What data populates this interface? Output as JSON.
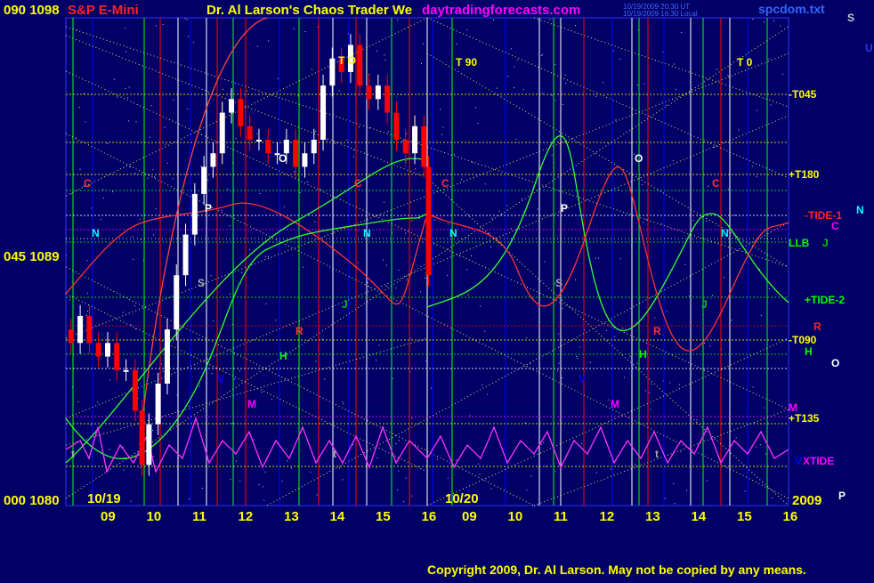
{
  "header": {
    "axis_top": "090  1098",
    "instrument": "S&P E-Mini",
    "title": "Dr. Al Larson's Chaos Trader We",
    "site": "daytradingforecasts.com",
    "stamp_line1": "10/19/2009 20:30 UT",
    "stamp_line2": "10/19/2009 16:30 Local",
    "file": "spcdom.txt",
    "corner_glyph": "S",
    "corner_glyph_2": "U"
  },
  "footer": {
    "copyright": "Copyright 2009, Dr. Al Larson. May not be copied by any means.",
    "year": "2009",
    "year_glyph": "P"
  },
  "colors": {
    "background": "#000066",
    "grid_blue": "#0000ff",
    "grid_red": "#ff0000",
    "grid_green": "#00ff00",
    "grid_white": "#ffffff",
    "yellow": "#ffff00",
    "magenta": "#ff00ff",
    "cyan": "#00ffff",
    "price_up": "#ffffff",
    "price_down": "#ff0000"
  },
  "chart_data": {
    "type": "candlestick",
    "title": "S&P E-Mini",
    "ylabels": [
      "090  1098",
      "045  1089",
      "000  1080"
    ],
    "ylim": [
      1080,
      1098
    ],
    "x_ticks": [
      "09",
      "10",
      "11",
      "12",
      "13",
      "14",
      "15",
      "16",
      "09",
      "10",
      "11",
      "12",
      "13",
      "14",
      "15",
      "16"
    ],
    "date_labels": [
      "10/19",
      "10/20"
    ],
    "right_labels": [
      {
        "text": "-T045",
        "color": "#ffff00"
      },
      {
        "text": "+T180",
        "color": "#ffff00"
      },
      {
        "text": "-TIDE-1",
        "color": "#ff2222"
      },
      {
        "text": "C",
        "color": "#ff00ff"
      },
      {
        "text": "N",
        "color": "#00ffff"
      },
      {
        "text": "LLB",
        "color": "#00ff00"
      },
      {
        "text": "J",
        "color": "#00cc00"
      },
      {
        "text": "+TIDE-2",
        "color": "#00ff00"
      },
      {
        "text": "R",
        "color": "#ff2222"
      },
      {
        "text": "-T090",
        "color": "#ffff00"
      },
      {
        "text": "H",
        "color": "#00ff00"
      },
      {
        "text": "O",
        "color": "#ffffff"
      },
      {
        "text": "M",
        "color": "#ff00ff"
      },
      {
        "text": "+T135",
        "color": "#ffff00"
      },
      {
        "text": "XTIDE",
        "color": "#ff00ff"
      },
      {
        "text": "V",
        "color": "#0000ff"
      }
    ],
    "top_right_labels": [
      {
        "text": "T  90",
        "color": "#ffff00"
      },
      {
        "text": "T  O",
        "color": "#ffff00"
      },
      {
        "text": "T   0",
        "color": "#ffff00"
      }
    ],
    "planet_labels": [
      {
        "text": "C",
        "color": "#ff3333"
      },
      {
        "text": "C",
        "color": "#ff3333"
      },
      {
        "text": "C",
        "color": "#ff3333"
      },
      {
        "text": "C",
        "color": "#ff3333"
      },
      {
        "text": "N",
        "color": "#00ffff"
      },
      {
        "text": "N",
        "color": "#00ffff"
      },
      {
        "text": "N",
        "color": "#00ffff"
      },
      {
        "text": "N",
        "color": "#00ffff"
      },
      {
        "text": "P",
        "color": "#ffffff"
      },
      {
        "text": "P",
        "color": "#ffffff"
      },
      {
        "text": "O",
        "color": "#ffffff"
      },
      {
        "text": "O",
        "color": "#ffffff"
      },
      {
        "text": "S",
        "color": "#aaaaaa"
      },
      {
        "text": "S",
        "color": "#aaaaaa"
      },
      {
        "text": "R",
        "color": "#ff3333"
      },
      {
        "text": "R",
        "color": "#ff3333"
      },
      {
        "text": "H",
        "color": "#00ff00"
      },
      {
        "text": "H",
        "color": "#00ff00"
      },
      {
        "text": "V",
        "color": "#0000ff"
      },
      {
        "text": "V",
        "color": "#0000ff"
      },
      {
        "text": "M",
        "color": "#ff00ff"
      },
      {
        "text": "M",
        "color": "#ff00ff"
      },
      {
        "text": "J",
        "color": "#00cc00"
      },
      {
        "text": "J",
        "color": "#00cc00"
      },
      {
        "text": "t",
        "color": "#aaaaaa"
      },
      {
        "text": "t",
        "color": "#aaaaaa"
      },
      {
        "text": "t",
        "color": "#aaaaaa"
      }
    ],
    "price_series": {
      "x": [
        8.0,
        8.2,
        8.4,
        8.6,
        8.8,
        9.0,
        9.2,
        9.4,
        9.6,
        9.75,
        9.9,
        10.1,
        10.3,
        10.5,
        10.7,
        10.9,
        11.1,
        11.3,
        11.5,
        11.7,
        11.9,
        12.1,
        12.3,
        12.5,
        12.7,
        12.9,
        13.1,
        13.3,
        13.5,
        13.7,
        13.9,
        14.1,
        14.3,
        14.5,
        14.7,
        14.9,
        15.1,
        15.3,
        15.5,
        15.7,
        15.9,
        16.0
      ],
      "y": [
        1086.5,
        1086.0,
        1087.0,
        1086.0,
        1085.5,
        1086.0,
        1085.0,
        1085.0,
        1083.5,
        1081.5,
        1083.0,
        1084.5,
        1086.5,
        1088.5,
        1090.0,
        1091.5,
        1092.5,
        1093.0,
        1094.5,
        1095.0,
        1094.0,
        1093.5,
        1093.5,
        1093.0,
        1093.0,
        1093.5,
        1092.5,
        1093.0,
        1093.5,
        1095.5,
        1096.5,
        1096.0,
        1097.0,
        1095.5,
        1095.0,
        1095.5,
        1094.5,
        1093.5,
        1093.0,
        1094.0,
        1092.5,
        1088.5
      ]
    }
  }
}
